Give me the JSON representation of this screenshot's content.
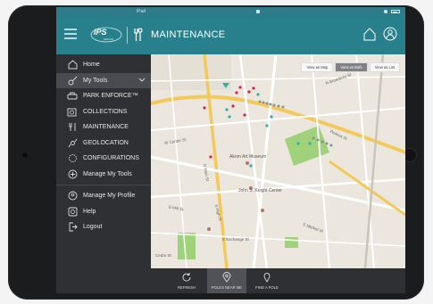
{
  "status_bar": {
    "carrier": "iPad"
  },
  "header": {
    "logo_text": "IPS",
    "logo_sub": "GROUP",
    "title": "MAINTENANCE"
  },
  "sidebar": {
    "items": [
      {
        "label": "Home",
        "icon": "home-icon"
      },
      {
        "label": "My Tools",
        "icon": "tools-icon",
        "active": true
      },
      {
        "label": "PARK ENFORCE™",
        "icon": "car-icon"
      },
      {
        "label": "COLLECTIONS",
        "icon": "coins-icon"
      },
      {
        "label": "MAINTENANCE",
        "icon": "wrench-icon"
      },
      {
        "label": "GEOLOCATION",
        "icon": "location-icon"
      },
      {
        "label": "CONFIGURATIONS",
        "icon": "config-icon"
      },
      {
        "label": "Manage My Tools",
        "icon": "plus-circle-icon"
      },
      {
        "label": "Manage My Profile",
        "icon": "profile-icon"
      },
      {
        "label": "Help",
        "icon": "help-icon"
      },
      {
        "label": "Logout",
        "icon": "logout-icon"
      }
    ]
  },
  "map": {
    "view_buttons": [
      "View as Map",
      "View as Both",
      "View as List"
    ],
    "selected_view": "View as Both",
    "labels": [
      "Akron Art Museum",
      "John S. Knight Center",
      "E Market St",
      "N Broadway St",
      "N Main St",
      "S High St",
      "E Mill St",
      "Perkins St",
      "W Center St",
      "E Exchange St",
      "Cedar St"
    ]
  },
  "toolbar": {
    "items": [
      {
        "label": "REFRESH",
        "icon": "refresh-icon"
      },
      {
        "label": "POLES NEAR ME",
        "icon": "location-pin-icon",
        "selected": true
      },
      {
        "label": "FIND A POLE",
        "icon": "find-pin-icon"
      }
    ]
  },
  "colors": {
    "header": "#27808c",
    "sidebar": "#2f3034",
    "marker_red": "#d8243c",
    "marker_teal": "#2bb3a8",
    "park_green": "#9fd27a"
  }
}
